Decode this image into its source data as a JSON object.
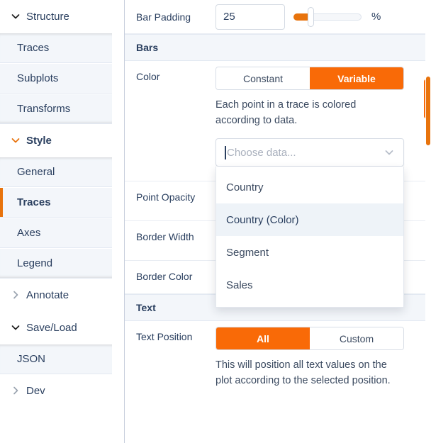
{
  "sidebar": {
    "groups": [
      {
        "label": "Structure",
        "chevron": "chevron-down-icon",
        "expanded": true,
        "accent": false,
        "items": [
          {
            "label": "Traces",
            "active": false
          },
          {
            "label": "Subplots",
            "active": false
          },
          {
            "label": "Transforms",
            "active": false
          }
        ]
      },
      {
        "label": "Style",
        "chevron": "chevron-down-icon",
        "expanded": true,
        "accent": true,
        "items": [
          {
            "label": "General",
            "active": false
          },
          {
            "label": "Traces",
            "active": true
          },
          {
            "label": "Axes",
            "active": false
          },
          {
            "label": "Legend",
            "active": false
          }
        ]
      },
      {
        "label": "Annotate",
        "chevron": "chevron-right-icon",
        "expanded": false,
        "accent": false,
        "items": []
      },
      {
        "label": "Save/Load",
        "chevron": "chevron-down-icon",
        "expanded": true,
        "accent": false,
        "items": [
          {
            "label": "JSON",
            "active": false
          }
        ]
      },
      {
        "label": "Dev",
        "chevron": "chevron-right-icon",
        "expanded": false,
        "accent": false,
        "items": []
      }
    ]
  },
  "panel": {
    "bar_padding": {
      "label": "Bar Padding",
      "value": "25",
      "unit": "%",
      "slider_percent": 25
    },
    "bars_section": {
      "title": "Bars",
      "color": {
        "label": "Color",
        "options": [
          "Constant",
          "Variable"
        ],
        "selected": "Variable",
        "help": "Each point in a trace is colored according to data.",
        "dropdown": {
          "placeholder": "Choose data...",
          "value": "",
          "open": true,
          "chevron": "chevron-down-icon",
          "options": [
            {
              "label": "Country",
              "highlighted": false
            },
            {
              "label": "Country (Color)",
              "highlighted": true
            },
            {
              "label": "Segment",
              "highlighted": false
            },
            {
              "label": "Sales",
              "highlighted": false
            }
          ]
        }
      },
      "point_opacity": {
        "label": "Point Opacity"
      },
      "border_width": {
        "label": "Border Width"
      },
      "border_color": {
        "label": "Border Color"
      }
    },
    "text_section": {
      "title": "Text",
      "text_position": {
        "label": "Text Position",
        "options": [
          "All",
          "Custom"
        ],
        "selected": "All",
        "help": "This will position all text values on the plot according to the selected position."
      }
    }
  },
  "colors": {
    "accent_orange": "#f96a07",
    "scrollbar_orange": "#e8730c",
    "text_navy": "#2a3f5f",
    "sub_item_bg": "#f3f6fa",
    "highlight_bg": "#eef3f8"
  }
}
